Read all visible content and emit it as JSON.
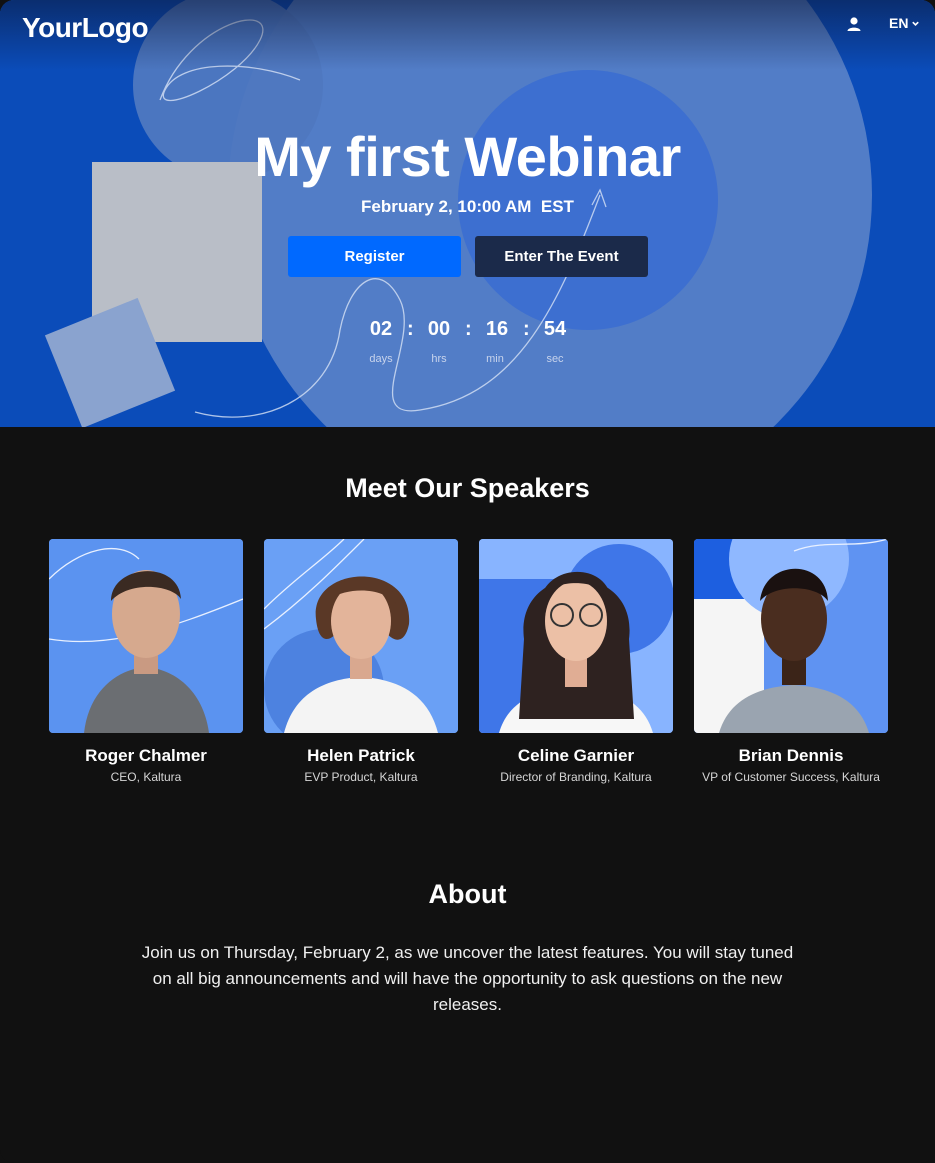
{
  "header": {
    "logo": "YourLogo",
    "language": "EN",
    "user_icon": "user-icon",
    "language_icon": "chevron-down-icon"
  },
  "hero": {
    "title": "My first Webinar",
    "date": "February 2, 10:00 AM  EST",
    "register_label": "Register",
    "enter_label": "Enter The Event",
    "countdown": {
      "days": "02",
      "days_label": "days",
      "hrs": "00",
      "hrs_label": "hrs",
      "min": "16",
      "min_label": "min",
      "sec": "54",
      "sec_label": "sec",
      "separator": ":"
    }
  },
  "speakers": {
    "title": "Meet Our Speakers",
    "items": [
      {
        "name": "Roger Chalmer",
        "role": "CEO, Kaltura"
      },
      {
        "name": "Helen Patrick",
        "role": "EVP Product, Kaltura"
      },
      {
        "name": "Celine Garnier",
        "role": "Director of Branding, Kaltura"
      },
      {
        "name": "Brian Dennis",
        "role": "VP of Customer Success, Kaltura"
      }
    ]
  },
  "about": {
    "title": "About",
    "text": "Join us on Thursday, February 2, as we uncover the latest features. You will stay tuned on all big announcements and will have the opportunity to ask questions on the new releases."
  },
  "colors": {
    "hero_blue": "#0a4ab8",
    "register_blue": "#0069ff",
    "enter_navy": "#1b2a4a",
    "page_bg": "#111111",
    "card_blue": "#7fb0ff"
  }
}
